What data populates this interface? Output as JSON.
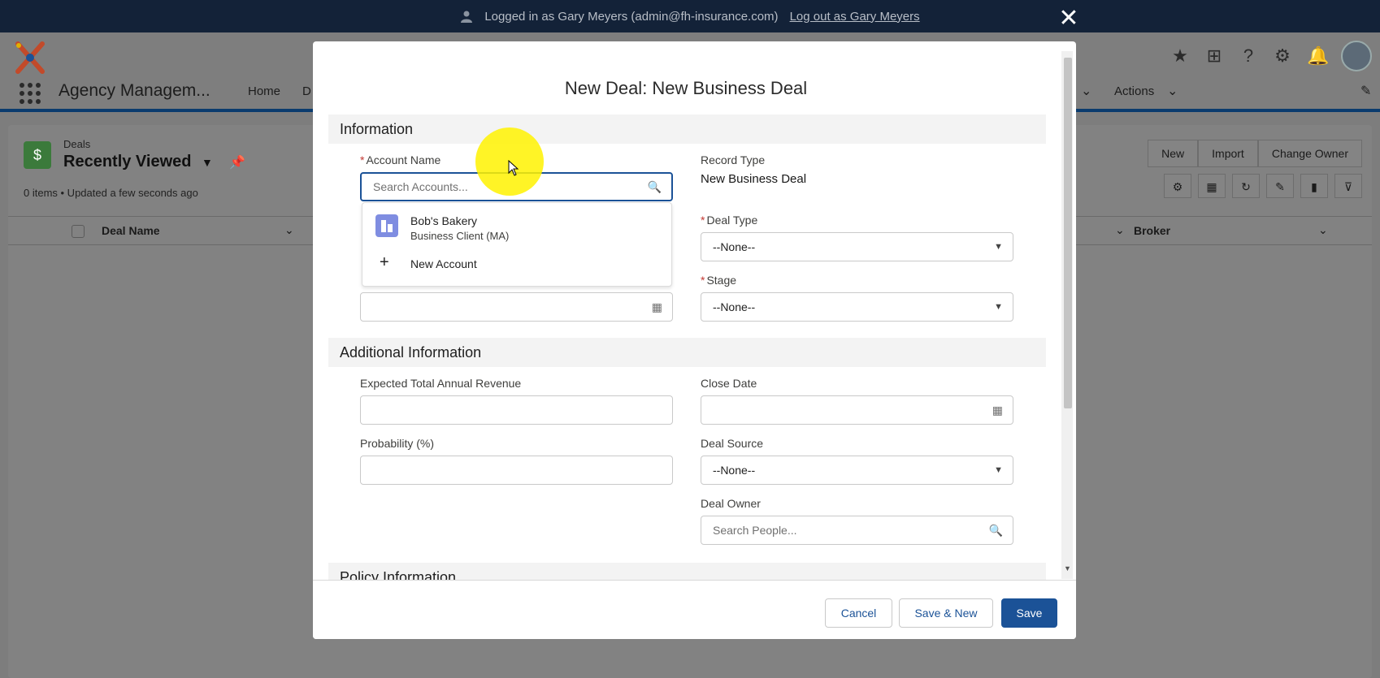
{
  "login_bar": {
    "text": "Logged in as Gary Meyers (admin@fh-insurance.com)",
    "logout_link": "Log out as Gary Meyers"
  },
  "app": {
    "name": "Agency Managem...",
    "nav": {
      "home": "Home",
      "partial_tab": "D",
      "actions": "Actions"
    },
    "header_icons": [
      "star-icon",
      "add-icon",
      "help-icon",
      "gear-icon",
      "bell-icon",
      "avatar"
    ]
  },
  "list_view": {
    "object_name": "Deals",
    "view_name": "Recently Viewed",
    "meta": "0 items • Updated a few seconds ago",
    "buttons": [
      "New",
      "Import",
      "Change Owner"
    ],
    "columns": [
      "Deal Name",
      "Broker"
    ]
  },
  "modal": {
    "title": "New Deal: New Business Deal",
    "sections": {
      "information": "Information",
      "additional": "Additional Information",
      "policy": "Policy Information"
    },
    "fields": {
      "account_name_label": "Account Name",
      "account_name_placeholder": "Search Accounts...",
      "record_type_label": "Record Type",
      "record_type_value": "New Business Deal",
      "deal_type_label": "Deal Type",
      "deal_type_value": "--None--",
      "stage_label": "Stage",
      "stage_value": "--None--",
      "expected_revenue_label": "Expected Total Annual Revenue",
      "expected_revenue_value": "",
      "close_date_label": "Close Date",
      "close_date_value": "",
      "probability_label": "Probability (%)",
      "probability_value": "",
      "deal_source_label": "Deal Source",
      "deal_source_value": "--None--",
      "deal_owner_label": "Deal Owner",
      "deal_owner_placeholder": "Search People..."
    },
    "lookup_results": {
      "account": {
        "name": "Bob's Bakery",
        "subtitle": "Business Client (MA)"
      },
      "new_account": "New Account"
    },
    "footer": {
      "cancel": "Cancel",
      "save_new": "Save & New",
      "save": "Save"
    }
  },
  "colors": {
    "brand_blue": "#1b5297",
    "required": "#c23934",
    "login_bar": "#132238",
    "cursor_highlight": "#fff200"
  }
}
